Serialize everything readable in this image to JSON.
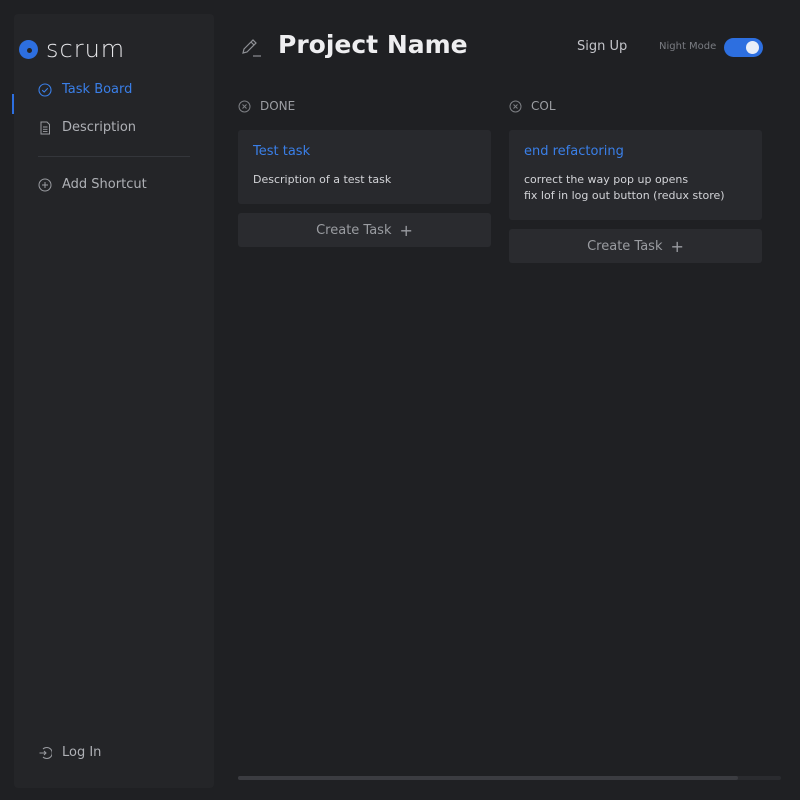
{
  "app": {
    "logo_text": "scrum"
  },
  "sidebar": {
    "items": [
      {
        "label": "Task Board",
        "icon": "check-circle-icon",
        "active": true
      },
      {
        "label": "Description",
        "icon": "document-icon",
        "active": false
      }
    ],
    "add_shortcut_label": "Add Shortcut",
    "login_label": "Log In"
  },
  "header": {
    "title": "Project Name",
    "signup_label": "Sign Up",
    "night_mode_label": "Night Mode",
    "night_mode_on": true
  },
  "columns": [
    {
      "name": "DONE",
      "tasks": [
        {
          "title": "Test task",
          "description_lines": [
            "Description of a test task"
          ]
        }
      ],
      "create_label": "Create Task"
    },
    {
      "name": "COL",
      "tasks": [
        {
          "title": "end refactoring",
          "description_lines": [
            "correct the way pop up opens",
            "fix lof in log out button (redux store)"
          ]
        }
      ],
      "create_label": "Create Task"
    }
  ],
  "colors": {
    "accent": "#2d6fe0",
    "background": "#1f2023",
    "sidebar": "#242528",
    "card": "#28292d"
  }
}
